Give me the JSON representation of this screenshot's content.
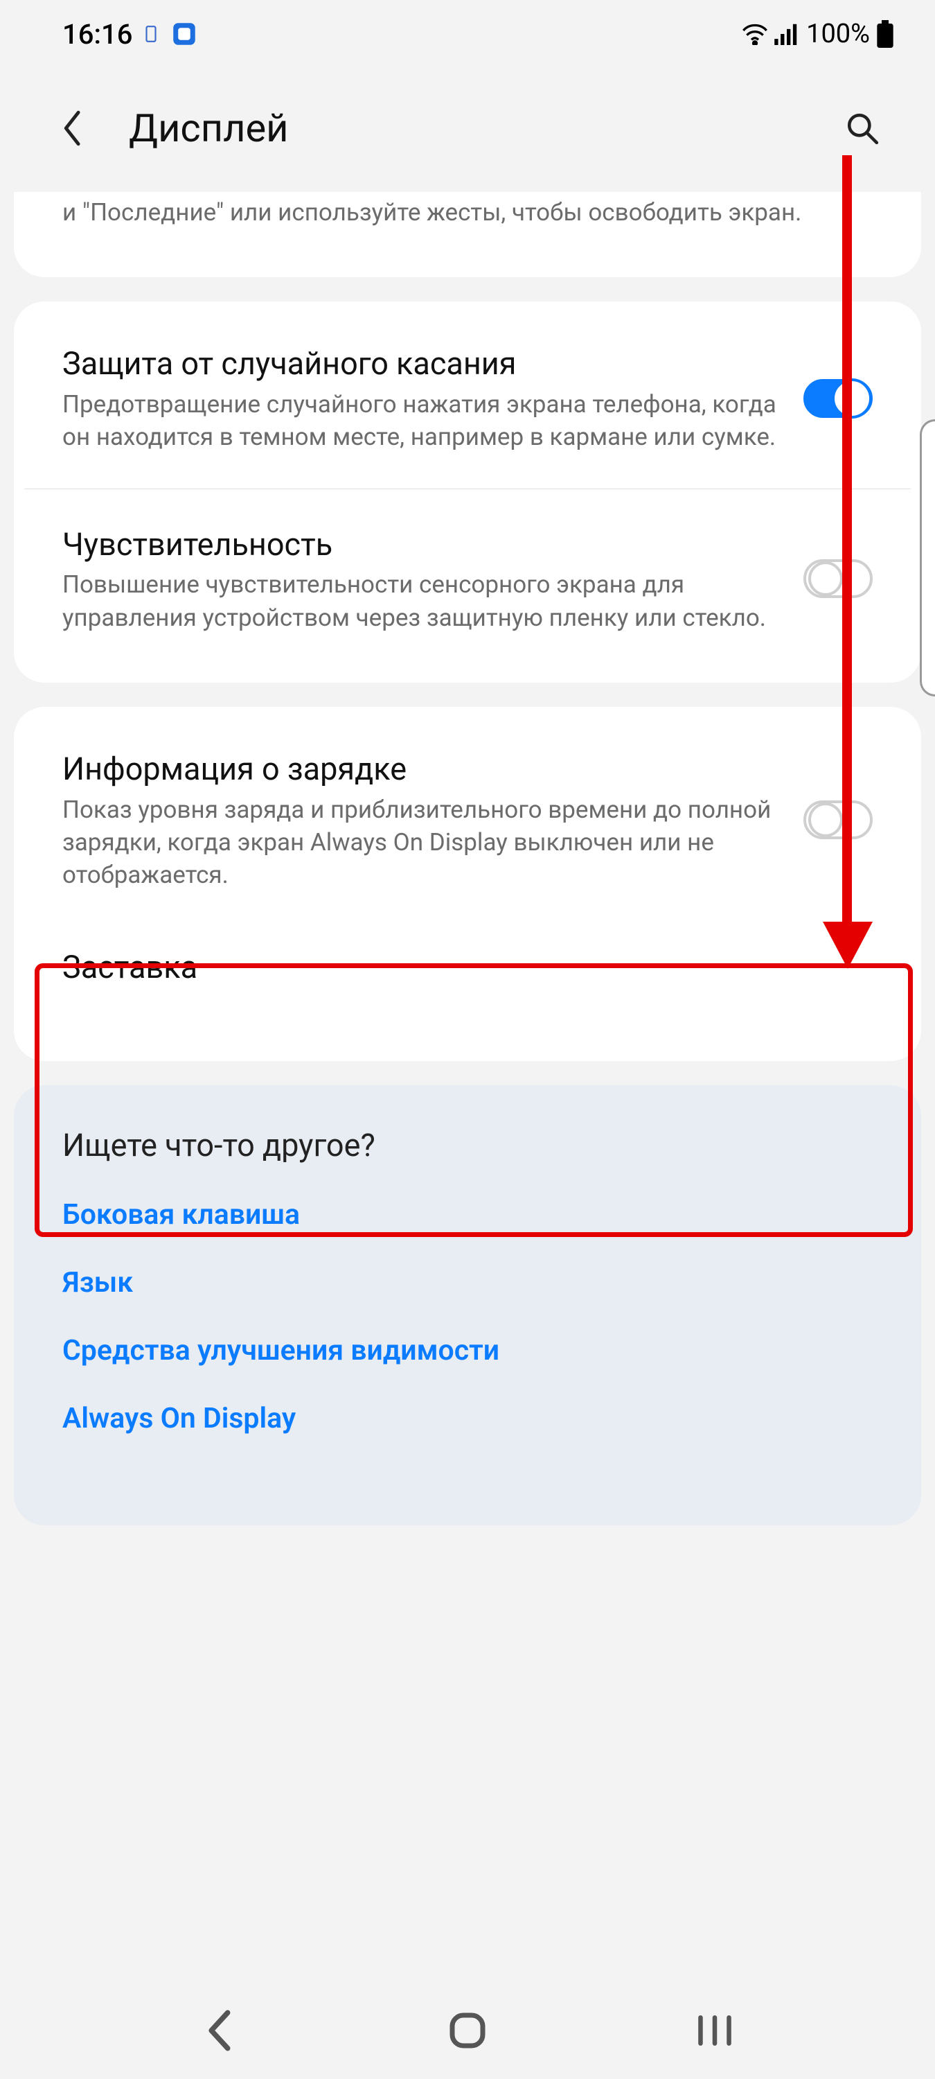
{
  "statusbar": {
    "time": "16:16",
    "battery": "100%"
  },
  "appbar": {
    "title": "Дисплей"
  },
  "card0": {
    "partial_subtitle": "и \"Последние\" или используйте жесты, чтобы освободить экран."
  },
  "card1": {
    "row1_title": "Защита от случайного касания",
    "row1_sub": "Предотвращение случайного нажатия экрана телефона, когда он находится в темном месте, например в кармане или сумке.",
    "row1_on": true,
    "row2_title": "Чувствительность",
    "row2_sub": "Повышение чувствительности сенсорного экрана для управления устройством через защитную пленку или стекло.",
    "row2_on": false
  },
  "card2": {
    "row1_title": "Информация о зарядке",
    "row1_sub": "Показ уровня заряда и приблизительного времени до полной зарядки, когда экран Always On Display выключен или не отображается.",
    "row1_on": false,
    "row2_title": "Заставка"
  },
  "footer": {
    "heading": "Ищете что-то другое?",
    "link1": "Боковая клавиша",
    "link2": "Язык",
    "link3": "Средства улучшения видимости",
    "link4": "Always On Display"
  }
}
